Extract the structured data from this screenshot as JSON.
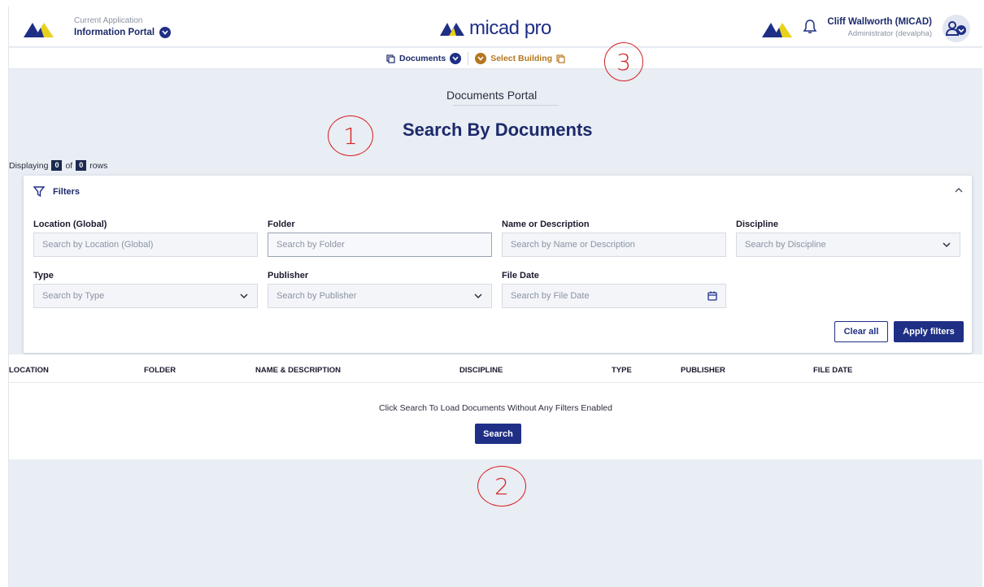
{
  "header": {
    "app_caption": "Current Application",
    "app_name": "Information Portal",
    "brand": "micad pro",
    "user_name": "Cliff Wallworth (MICAD)",
    "user_role": "Administrator (devalpha)"
  },
  "subnav": {
    "documents": "Documents",
    "select_building": "Select Building"
  },
  "annotations": [
    "1",
    "2",
    "3"
  ],
  "page": {
    "portal": "Documents Portal",
    "title": "Search By Documents",
    "displaying_prefix": "Displaying",
    "displaying_count": "0",
    "displaying_of": "of",
    "displaying_total": "0",
    "displaying_suffix": "rows"
  },
  "filters": {
    "title": "Filters",
    "location_label": "Location (Global)",
    "location_placeholder": "Search by Location (Global)",
    "folder_label": "Folder",
    "folder_placeholder": "Search by Folder",
    "name_label": "Name or Description",
    "name_placeholder": "Search by Name or Description",
    "discipline_label": "Discipline",
    "discipline_placeholder": "Search by Discipline",
    "type_label": "Type",
    "type_placeholder": "Search by Type",
    "publisher_label": "Publisher",
    "publisher_placeholder": "Search by Publisher",
    "filedate_label": "File Date",
    "filedate_placeholder": "Search by File Date",
    "clear_all": "Clear all",
    "apply": "Apply filters"
  },
  "table": {
    "columns": [
      "LOCATION",
      "FOLDER",
      "NAME & DESCRIPTION",
      "DISCIPLINE",
      "TYPE",
      "PUBLISHER",
      "FILE DATE"
    ],
    "empty_message": "Click Search To Load Documents Without Any Filters Enabled",
    "search_button": "Search"
  },
  "colors": {
    "brand_navy": "#1f2f86",
    "brand_yellow": "#e8d11a",
    "building_orange": "#b5761f",
    "annotation_red": "#d62020"
  }
}
